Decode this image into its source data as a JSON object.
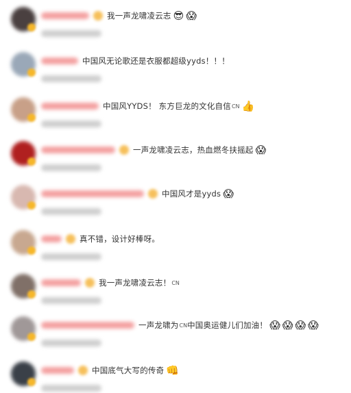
{
  "comments": [
    {
      "content": "我一声龙啸凌云志",
      "emojis": [
        "😎",
        "😱"
      ],
      "avatar_color": "#4a4040",
      "name_width": 70,
      "has_user_badge": true
    },
    {
      "content": "中国风无论歌还是衣服都超级yyds！！！",
      "emojis": [],
      "avatar_color": "#9aa8b8",
      "name_width": 54,
      "has_user_badge": false
    },
    {
      "content": "中国风YYDS！ 东方巨龙的文化自信",
      "cn": "CN",
      "emojis": [
        "👍"
      ],
      "avatar_color": "#c8a088",
      "name_width": 84,
      "has_user_badge": false
    },
    {
      "content": "一声龙啸凌云志，热血燃冬扶摇起",
      "emojis": [
        "😱"
      ],
      "avatar_color": "#b02020",
      "name_width": 108,
      "has_user_badge": true
    },
    {
      "content": "中国风才是yyds",
      "emojis": [
        "😱"
      ],
      "avatar_color": "#d8b8b0",
      "name_width": 150,
      "has_user_badge": true
    },
    {
      "content": "真不错，设计好棒呀。",
      "emojis": [],
      "avatar_color": "#c8a890",
      "name_width": 30,
      "has_user_badge": true
    },
    {
      "content": "我一声龙啸凌云志！",
      "cn": "CN",
      "emojis": [],
      "avatar_color": "#807068",
      "name_width": 58,
      "has_user_badge": true
    },
    {
      "content": "一声龙啸为",
      "cn": "CN",
      "content2": " 中国奥运健儿们加油！",
      "emojis": [
        "😱",
        "😱",
        "😱",
        "😱"
      ],
      "avatar_color": "#a09898",
      "name_width": 136,
      "has_user_badge": false
    },
    {
      "content": "中国底气大写的传奇",
      "emojis": [
        "👊"
      ],
      "avatar_color": "#3a4048",
      "name_width": 48,
      "has_user_badge": true
    }
  ]
}
